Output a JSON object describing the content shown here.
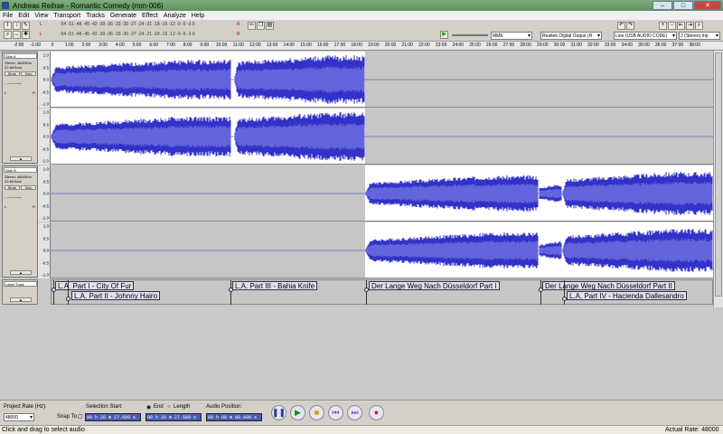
{
  "window": {
    "title": "Andreas Reihse - Romantic Comedy (mm-006)"
  },
  "menu": [
    "File",
    "Edit",
    "View",
    "Transport",
    "Tracks",
    "Generate",
    "Effect",
    "Analyze",
    "Help"
  ],
  "toolbar": {
    "meter_scale": "-54 -51 -48 -45 -42 -39 -36 -33 -30 -27 -24 -21 -18 -15 -12 -9 -6 -3 0",
    "meter_scale_2": "-54 -51 -48 -45 -42 -39 -36 -33 -30 -27 -24 -21 -18 -15 -12 -9 -6 -3 0",
    "left_label": "L",
    "right_label": "R",
    "host": "MME",
    "output_device": "Realtek Digital Output (R",
    "input_device": "Line (USB AUDIO CODE)",
    "input_channels": "2 (Stereo) Inp"
  },
  "ruler": [
    "-2:00",
    "-1:00",
    "0",
    "1:00",
    "2:00",
    "3:00",
    "4:00",
    "5:00",
    "6:00",
    "7:00",
    "8:00",
    "9:00",
    "10:00",
    "11:00",
    "12:00",
    "13:00",
    "14:00",
    "15:00",
    "16:00",
    "17:00",
    "18:00",
    "19:00",
    "20:00",
    "21:00",
    "22:00",
    "23:00",
    "24:00",
    "25:00",
    "26:00",
    "27:00",
    "28:00",
    "29:00",
    "30:00",
    "31:00",
    "32:00",
    "33:00",
    "34:00",
    "35:00",
    "36:00",
    "37:00",
    "38:00"
  ],
  "tracks": [
    {
      "name": "Side A",
      "info1": "Stereo, 48000Hz",
      "info2": "32-bit float",
      "mute": "Mute",
      "solo": "Solo",
      "pan_l": "L",
      "pan_r": "R",
      "collapse": "▲"
    },
    {
      "name": "Side B",
      "info1": "Stereo, 48000Hz",
      "info2": "32-bit float",
      "mute": "Mute",
      "solo": "Solo",
      "pan_l": "L",
      "pan_r": "R",
      "collapse": "▲"
    },
    {
      "name": "Label Track",
      "collapse": "▲"
    }
  ],
  "vscale": [
    "1.0",
    "0.5",
    "0.0",
    "-0.5",
    "-1.0"
  ],
  "labels": [
    {
      "text": "L.A. Part I - City Of Fur"
    },
    {
      "text": "L.A. Part II - Johnny Hairo"
    },
    {
      "text": "L.A. Part III - Bahia Knife"
    },
    {
      "text": "Der Lange Weg Nach Düsseldorf Part I"
    },
    {
      "text": "Der Lange Weg Nach Düsseldorf Part II"
    },
    {
      "text": "L.A. Part IV - Hacienda Dallesandro"
    }
  ],
  "selection": {
    "project_rate_label": "Project Rate (Hz):",
    "project_rate": "48000",
    "snap_label": "Snap To",
    "start_label": "Selection Start:",
    "end_label": "End",
    "length_label": "Length",
    "position_label": "Audio Position:",
    "start_value": "00 h 28 m 27.509 s",
    "end_value": "00 h 28 m 27.509 s",
    "position_value": "00 h 00 m 00.000 s"
  },
  "status": {
    "left": "Click and drag to select audio",
    "right": "Actual Rate: 48000"
  },
  "colors": {
    "wave": "#3232c8",
    "wave_light": "#6464dc",
    "selected_bg": "#ffffff"
  }
}
